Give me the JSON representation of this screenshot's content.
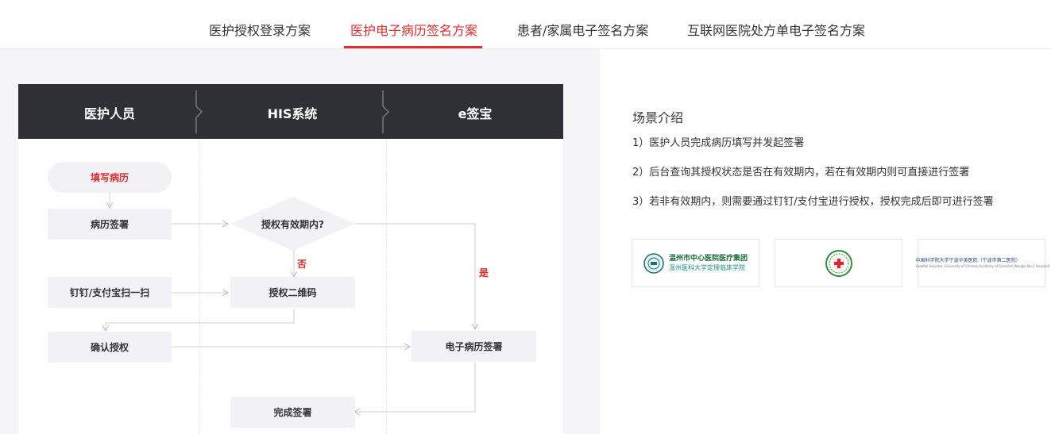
{
  "tabs": [
    {
      "label": "医护授权登录方案"
    },
    {
      "label": "医护电子病历签名方案",
      "active": true
    },
    {
      "label": "患者/家属电子签名方案"
    },
    {
      "label": "互联网医院处方单电子签名方案"
    }
  ],
  "colors": {
    "accent": "#e02d2d",
    "header_bg": "#2f3035",
    "node_bg": "#f2f2f6",
    "panel_bg": "#f5f5f7"
  },
  "flow": {
    "columns": [
      "医护人员",
      "HIS系统",
      "e签宝"
    ],
    "nodes": {
      "fill_record": "填写病历",
      "record_sign": "病历签署",
      "auth_valid": "授权有效期内?",
      "scan": "钉钉/支付宝扫一扫",
      "auth_qr": "授权二维码",
      "confirm_auth": "确认授权",
      "emr_sign": "电子病历签署",
      "complete_sign": "完成签署"
    },
    "edge_labels": {
      "no": "否",
      "yes": "是"
    }
  },
  "intro": {
    "title": "场景介绍",
    "lines": [
      "1）医护人员完成病历填写并发起签署",
      "2）后台查询其授权状态是否在有效期内，若在有效期内则可直接进行签署",
      "3）若非有效期内，则需要通过钉钉/支付宝进行授权，授权完成后即可进行签署"
    ]
  },
  "logos": [
    {
      "name": "温州市中心医院医疗集团",
      "line1": "温州市中心医院医疗集团",
      "line2": "温州医科大学定理临床学院"
    },
    {
      "name": "hospital-emblem"
    },
    {
      "name": "中国科学院大学宁波华美医院",
      "line1": "中国科学院大学宁波华美医院（宁波市第二医院）",
      "line2": "HwaMei Hospital, University of Chinese Academy of Sciences (Ningbo No.2 Hospital)"
    }
  ]
}
